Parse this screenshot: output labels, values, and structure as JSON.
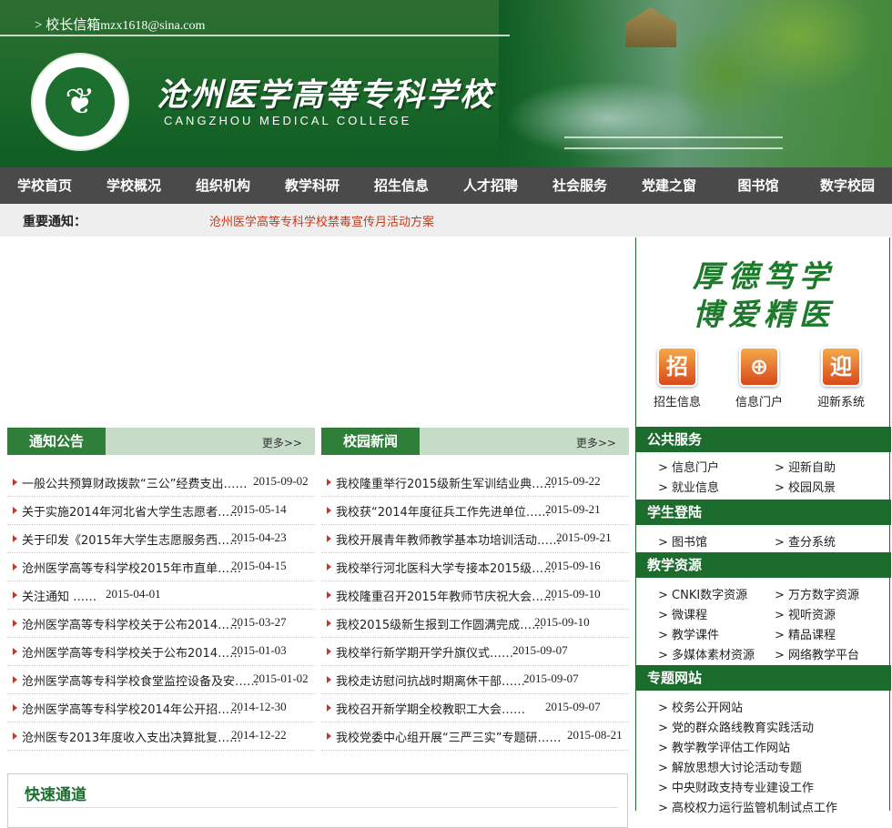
{
  "header": {
    "mail_label": "> 校长信箱",
    "mail_address": "mzx1618@sina.com",
    "school_name": "沧州医学高等专科学校",
    "school_name_en": "CANGZHOU MEDICAL COLLEGE",
    "logo_glyph": "❦"
  },
  "nav": {
    "items": [
      "学校首页",
      "学校概况",
      "组织机构",
      "教学科研",
      "招生信息",
      "人才招聘",
      "社会服务",
      "党建之窗",
      "图书馆",
      "数字校园"
    ]
  },
  "notice": {
    "label": "重要通知：",
    "text": "沧州医学高等专科学校禁毒宣传月活动方案"
  },
  "right": {
    "motto_line1": "厚德笃学",
    "motto_line2": "博爱精医",
    "quick_icons": [
      {
        "glyph": "招",
        "label": "招生信息",
        "icon": "enroll-icon"
      },
      {
        "glyph": "⊕",
        "label": "信息门户",
        "icon": "portal-icon"
      },
      {
        "glyph": "迎",
        "label": "迎新系统",
        "icon": "welcome-icon"
      }
    ],
    "sections": [
      {
        "title": "公共服务",
        "links": [
          "> 信息门户",
          "> 迎新自助",
          "> 就业信息",
          "> 校园风景"
        ]
      },
      {
        "title": "学生登陆",
        "links": [
          "> 图书馆",
          "> 查分系统"
        ]
      },
      {
        "title": "教学资源",
        "links": [
          "> CNKI数字资源",
          "> 万方数字资源",
          "> 微课程",
          "> 视听资源",
          "> 教学课件",
          "> 精品课程",
          "> 多媒体素材资源",
          "> 网络教学平台"
        ]
      },
      {
        "title": "专题网站",
        "links": [
          "> 校务公开网站",
          "> 党的群众路线教育实践活动",
          "> 教学教学评估工作网站",
          "> 解放思想大讨论活动专题",
          "> 中央财政支持专业建设工作",
          "> 高校权力运行监管机制试点工作"
        ]
      }
    ]
  },
  "notices": {
    "title": "通知公告",
    "more": "更多>>",
    "items": [
      {
        "title": "一般公共预算财政拨款“三公”经费支出……",
        "date": "2015-09-02"
      },
      {
        "title": "关于实施2014年河北省大学生志愿者……",
        "date": "2015-05-14"
      },
      {
        "title": "关于印发《2015年大学生志愿服务西……",
        "date": "2015-04-23"
      },
      {
        "title": "沧州医学高等专科学校2015年市直单……",
        "date": "2015-04-15"
      },
      {
        "title": "关注通知  ……",
        "date": "2015-04-01"
      },
      {
        "title": "沧州医学高等专科学校关于公布2014……",
        "date": "2015-03-27"
      },
      {
        "title": "沧州医学高等专科学校关于公布2014……",
        "date": "2015-01-03"
      },
      {
        "title": "沧州医学高等专科学校食堂监控设备及安……",
        "date": "2015-01-02"
      },
      {
        "title": "沧州医学高等专科学校2014年公开招……",
        "date": "2014-12-30"
      },
      {
        "title": "沧州医专2013年度收入支出决算批复……",
        "date": "2014-12-22"
      }
    ]
  },
  "news": {
    "title": "校园新闻",
    "more": "更多>>",
    "items": [
      {
        "title": "我校隆重举行2015级新生军训结业典……",
        "date": "2015-09-22"
      },
      {
        "title": "我校获“2014年度征兵工作先进单位……",
        "date": "2015-09-21"
      },
      {
        "title": "我校开展青年教师教学基本功培训活动……",
        "date": "2015-09-21"
      },
      {
        "title": "我校举行河北医科大学专接本2015级……",
        "date": "2015-09-16"
      },
      {
        "title": "我校隆重召开2015年教师节庆祝大会……",
        "date": "2015-09-10"
      },
      {
        "title": "我校2015级新生报到工作圆满完成……",
        "date": "2015-09-10"
      },
      {
        "title": "我校举行新学期开学升旗仪式……",
        "date": "2015-09-07"
      },
      {
        "title": "我校走访慰问抗战时期离休干部……",
        "date": "2015-09-07"
      },
      {
        "title": "我校召开新学期全校教职工大会……",
        "date": "2015-09-07"
      },
      {
        "title": "我校党委中心组开展“三严三实”专题研……",
        "date": "2015-08-21"
      }
    ]
  },
  "quick_access": {
    "title": "快速通道"
  }
}
